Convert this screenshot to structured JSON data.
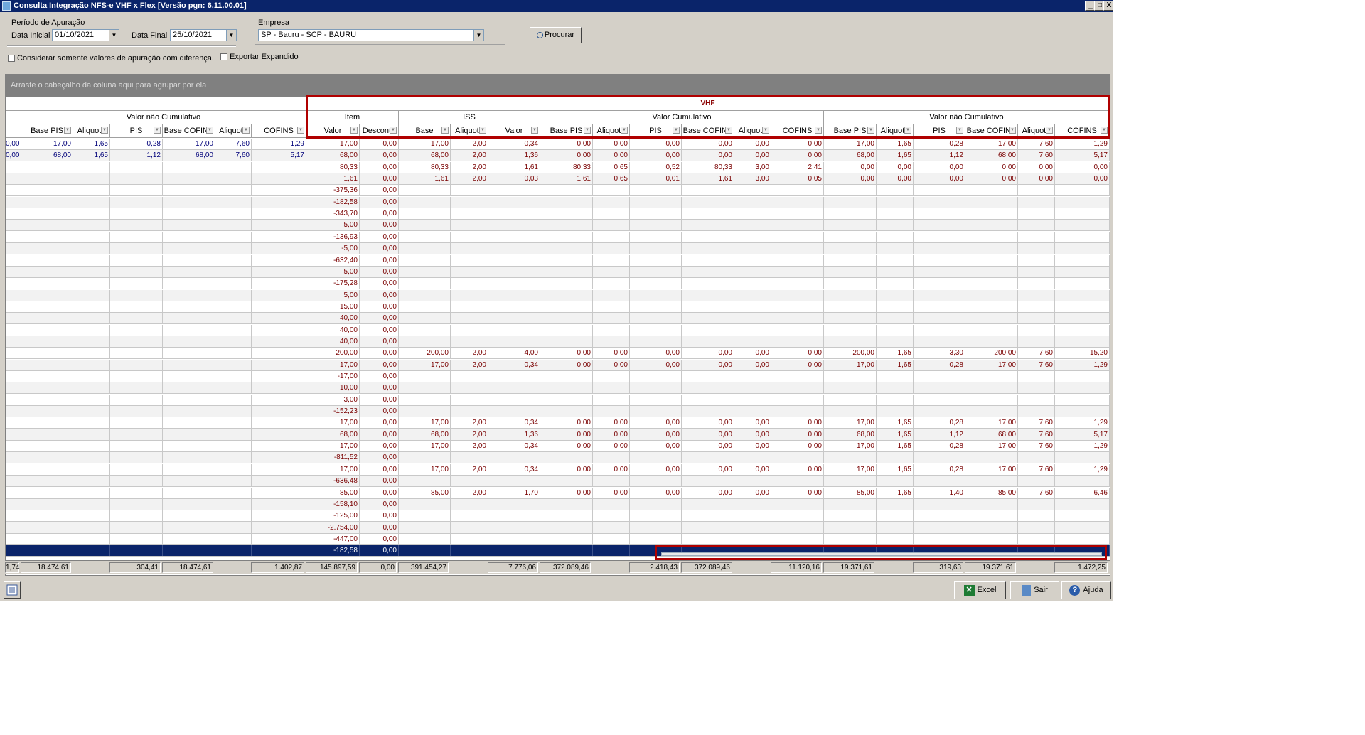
{
  "window": {
    "title": "Consulta Integração NFS-e VHF x Flex [Versão pgn: 6.11.00.01]",
    "buttons": [
      "_",
      "□",
      "X"
    ]
  },
  "filters": {
    "periodo_label": "Período de Apuração",
    "data_inicial_label": "Data Inicial",
    "data_inicial_value": "01/10/2021",
    "data_final_label": "Data Final",
    "data_final_value": "25/10/2021",
    "empresa_label": "Empresa",
    "empresa_value": "SP - Bauru - SCP - BAURU",
    "procurar_label": "Procurar",
    "considerar_label": "Considerar somente valores de apuração com diferença.",
    "exportar_label": "Exportar Expandido"
  },
  "grid": {
    "group_hint": "Arraste o cabeçalho da coluna aqui para agrupar por ela",
    "top_band": "VHF",
    "bands": [
      {
        "id": "vnc1",
        "label": "Valor não Cumulativo"
      },
      {
        "id": "item",
        "label": "Item"
      },
      {
        "id": "iss",
        "label": "ISS"
      },
      {
        "id": "vc",
        "label": "Valor Cumulativo"
      },
      {
        "id": "vnc2",
        "label": "Valor não Cumulativo"
      }
    ],
    "columns": [
      "",
      "Base PIS",
      "Aliquota",
      "PIS",
      "Base COFINS",
      "Aliquota",
      "COFINS",
      "Valor",
      "Desconto",
      "Base",
      "Aliquota",
      "Valor",
      "Base PIS",
      "Aliquota",
      "PIS",
      "Base COFINS",
      "Aliquota",
      "COFINS",
      "Base PIS",
      "Aliquota",
      "PIS",
      "Base COFINS",
      "Aliquota",
      "COFINS"
    ],
    "rows": [
      [
        "0,00",
        "17,00",
        "1,65",
        "0,28",
        "17,00",
        "7,60",
        "1,29",
        "17,00",
        "0,00",
        "17,00",
        "2,00",
        "0,34",
        "0,00",
        "0,00",
        "0,00",
        "0,00",
        "0,00",
        "0,00",
        "17,00",
        "1,65",
        "0,28",
        "17,00",
        "7,60",
        "1,29"
      ],
      [
        "0,00",
        "68,00",
        "1,65",
        "1,12",
        "68,00",
        "7,60",
        "5,17",
        "68,00",
        "0,00",
        "68,00",
        "2,00",
        "1,36",
        "0,00",
        "0,00",
        "0,00",
        "0,00",
        "0,00",
        "0,00",
        "68,00",
        "1,65",
        "1,12",
        "68,00",
        "7,60",
        "5,17"
      ],
      [
        "",
        "",
        "",
        "",
        "",
        "",
        "",
        "80,33",
        "0,00",
        "80,33",
        "2,00",
        "1,61",
        "80,33",
        "0,65",
        "0,52",
        "80,33",
        "3,00",
        "2,41",
        "0,00",
        "0,00",
        "0,00",
        "0,00",
        "0,00",
        "0,00"
      ],
      [
        "",
        "",
        "",
        "",
        "",
        "",
        "",
        "1,61",
        "0,00",
        "1,61",
        "2,00",
        "0,03",
        "1,61",
        "0,65",
        "0,01",
        "1,61",
        "3,00",
        "0,05",
        "0,00",
        "0,00",
        "0,00",
        "0,00",
        "0,00",
        "0,00"
      ],
      [
        "",
        "",
        "",
        "",
        "",
        "",
        "",
        "-375,36",
        "0,00",
        "",
        "",
        "",
        "",
        "",
        "",
        "",
        "",
        "",
        "",
        "",
        "",
        "",
        "",
        ""
      ],
      [
        "",
        "",
        "",
        "",
        "",
        "",
        "",
        "-182,58",
        "0,00",
        "",
        "",
        "",
        "",
        "",
        "",
        "",
        "",
        "",
        "",
        "",
        "",
        "",
        "",
        ""
      ],
      [
        "",
        "",
        "",
        "",
        "",
        "",
        "",
        "-343,70",
        "0,00",
        "",
        "",
        "",
        "",
        "",
        "",
        "",
        "",
        "",
        "",
        "",
        "",
        "",
        "",
        ""
      ],
      [
        "",
        "",
        "",
        "",
        "",
        "",
        "",
        "5,00",
        "0,00",
        "",
        "",
        "",
        "",
        "",
        "",
        "",
        "",
        "",
        "",
        "",
        "",
        "",
        "",
        ""
      ],
      [
        "",
        "",
        "",
        "",
        "",
        "",
        "",
        "-136,93",
        "0,00",
        "",
        "",
        "",
        "",
        "",
        "",
        "",
        "",
        "",
        "",
        "",
        "",
        "",
        "",
        ""
      ],
      [
        "",
        "",
        "",
        "",
        "",
        "",
        "",
        "-5,00",
        "0,00",
        "",
        "",
        "",
        "",
        "",
        "",
        "",
        "",
        "",
        "",
        "",
        "",
        "",
        "",
        ""
      ],
      [
        "",
        "",
        "",
        "",
        "",
        "",
        "",
        "-632,40",
        "0,00",
        "",
        "",
        "",
        "",
        "",
        "",
        "",
        "",
        "",
        "",
        "",
        "",
        "",
        "",
        ""
      ],
      [
        "",
        "",
        "",
        "",
        "",
        "",
        "",
        "5,00",
        "0,00",
        "",
        "",
        "",
        "",
        "",
        "",
        "",
        "",
        "",
        "",
        "",
        "",
        "",
        "",
        ""
      ],
      [
        "",
        "",
        "",
        "",
        "",
        "",
        "",
        "-175,28",
        "0,00",
        "",
        "",
        "",
        "",
        "",
        "",
        "",
        "",
        "",
        "",
        "",
        "",
        "",
        "",
        ""
      ],
      [
        "",
        "",
        "",
        "",
        "",
        "",
        "",
        "5,00",
        "0,00",
        "",
        "",
        "",
        "",
        "",
        "",
        "",
        "",
        "",
        "",
        "",
        "",
        "",
        "",
        ""
      ],
      [
        "",
        "",
        "",
        "",
        "",
        "",
        "",
        "15,00",
        "0,00",
        "",
        "",
        "",
        "",
        "",
        "",
        "",
        "",
        "",
        "",
        "",
        "",
        "",
        "",
        ""
      ],
      [
        "",
        "",
        "",
        "",
        "",
        "",
        "",
        "40,00",
        "0,00",
        "",
        "",
        "",
        "",
        "",
        "",
        "",
        "",
        "",
        "",
        "",
        "",
        "",
        "",
        ""
      ],
      [
        "",
        "",
        "",
        "",
        "",
        "",
        "",
        "40,00",
        "0,00",
        "",
        "",
        "",
        "",
        "",
        "",
        "",
        "",
        "",
        "",
        "",
        "",
        "",
        "",
        ""
      ],
      [
        "",
        "",
        "",
        "",
        "",
        "",
        "",
        "40,00",
        "0,00",
        "",
        "",
        "",
        "",
        "",
        "",
        "",
        "",
        "",
        "",
        "",
        "",
        "",
        "",
        ""
      ],
      [
        "",
        "",
        "",
        "",
        "",
        "",
        "",
        "200,00",
        "0,00",
        "200,00",
        "2,00",
        "4,00",
        "0,00",
        "0,00",
        "0,00",
        "0,00",
        "0,00",
        "0,00",
        "200,00",
        "1,65",
        "3,30",
        "200,00",
        "7,60",
        "15,20"
      ],
      [
        "",
        "",
        "",
        "",
        "",
        "",
        "",
        "17,00",
        "0,00",
        "17,00",
        "2,00",
        "0,34",
        "0,00",
        "0,00",
        "0,00",
        "0,00",
        "0,00",
        "0,00",
        "17,00",
        "1,65",
        "0,28",
        "17,00",
        "7,60",
        "1,29"
      ],
      [
        "",
        "",
        "",
        "",
        "",
        "",
        "",
        "-17,00",
        "0,00",
        "",
        "",
        "",
        "",
        "",
        "",
        "",
        "",
        "",
        "",
        "",
        "",
        "",
        "",
        ""
      ],
      [
        "",
        "",
        "",
        "",
        "",
        "",
        "",
        "10,00",
        "0,00",
        "",
        "",
        "",
        "",
        "",
        "",
        "",
        "",
        "",
        "",
        "",
        "",
        "",
        "",
        ""
      ],
      [
        "",
        "",
        "",
        "",
        "",
        "",
        "",
        "3,00",
        "0,00",
        "",
        "",
        "",
        "",
        "",
        "",
        "",
        "",
        "",
        "",
        "",
        "",
        "",
        "",
        ""
      ],
      [
        "",
        "",
        "",
        "",
        "",
        "",
        "",
        "-152,23",
        "0,00",
        "",
        "",
        "",
        "",
        "",
        "",
        "",
        "",
        "",
        "",
        "",
        "",
        "",
        "",
        ""
      ],
      [
        "",
        "",
        "",
        "",
        "",
        "",
        "",
        "17,00",
        "0,00",
        "17,00",
        "2,00",
        "0,34",
        "0,00",
        "0,00",
        "0,00",
        "0,00",
        "0,00",
        "0,00",
        "17,00",
        "1,65",
        "0,28",
        "17,00",
        "7,60",
        "1,29"
      ],
      [
        "",
        "",
        "",
        "",
        "",
        "",
        "",
        "68,00",
        "0,00",
        "68,00",
        "2,00",
        "1,36",
        "0,00",
        "0,00",
        "0,00",
        "0,00",
        "0,00",
        "0,00",
        "68,00",
        "1,65",
        "1,12",
        "68,00",
        "7,60",
        "5,17"
      ],
      [
        "",
        "",
        "",
        "",
        "",
        "",
        "",
        "17,00",
        "0,00",
        "17,00",
        "2,00",
        "0,34",
        "0,00",
        "0,00",
        "0,00",
        "0,00",
        "0,00",
        "0,00",
        "17,00",
        "1,65",
        "0,28",
        "17,00",
        "7,60",
        "1,29"
      ],
      [
        "",
        "",
        "",
        "",
        "",
        "",
        "",
        "-811,52",
        "0,00",
        "",
        "",
        "",
        "",
        "",
        "",
        "",
        "",
        "",
        "",
        "",
        "",
        "",
        "",
        ""
      ],
      [
        "",
        "",
        "",
        "",
        "",
        "",
        "",
        "17,00",
        "0,00",
        "17,00",
        "2,00",
        "0,34",
        "0,00",
        "0,00",
        "0,00",
        "0,00",
        "0,00",
        "0,00",
        "17,00",
        "1,65",
        "0,28",
        "17,00",
        "7,60",
        "1,29"
      ],
      [
        "",
        "",
        "",
        "",
        "",
        "",
        "",
        "-636,48",
        "0,00",
        "",
        "",
        "",
        "",
        "",
        "",
        "",
        "",
        "",
        "",
        "",
        "",
        "",
        "",
        ""
      ],
      [
        "",
        "",
        "",
        "",
        "",
        "",
        "",
        "85,00",
        "0,00",
        "85,00",
        "2,00",
        "1,70",
        "0,00",
        "0,00",
        "0,00",
        "0,00",
        "0,00",
        "0,00",
        "85,00",
        "1,65",
        "1,40",
        "85,00",
        "7,60",
        "6,46"
      ],
      [
        "",
        "",
        "",
        "",
        "",
        "",
        "",
        "-158,10",
        "0,00",
        "",
        "",
        "",
        "",
        "",
        "",
        "",
        "",
        "",
        "",
        "",
        "",
        "",
        "",
        ""
      ],
      [
        "",
        "",
        "",
        "",
        "",
        "",
        "",
        "-125,00",
        "0,00",
        "",
        "",
        "",
        "",
        "",
        "",
        "",
        "",
        "",
        "",
        "",
        "",
        "",
        "",
        ""
      ],
      [
        "",
        "",
        "",
        "",
        "",
        "",
        "",
        "-2.754,00",
        "0,00",
        "",
        "",
        "",
        "",
        "",
        "",
        "",
        "",
        "",
        "",
        "",
        "",
        "",
        "",
        ""
      ],
      [
        "",
        "",
        "",
        "",
        "",
        "",
        "",
        "-447,00",
        "0,00",
        "",
        "",
        "",
        "",
        "",
        "",
        "",
        "",
        "",
        "",
        "",
        "",
        "",
        "",
        ""
      ],
      [
        "",
        "",
        "",
        "",
        "",
        "",
        "",
        "-182,58",
        "0,00",
        "",
        "",
        "",
        "",
        "",
        "",
        "",
        "",
        "",
        "",
        "",
        "",
        "",
        "",
        ""
      ]
    ],
    "selected_row": 35,
    "totals": [
      "1,74",
      "18.474,61",
      "",
      "304,41",
      "18.474,61",
      "",
      "1.402,87",
      "145.897,59",
      "0,00",
      "391.454,27",
      "",
      "7.776,06",
      "372.089,46",
      "",
      "2.418,43",
      "372.089,46",
      "",
      "11.120,16",
      "19.371,61",
      "",
      "319,63",
      "19.371,61",
      "",
      "1.472,25"
    ]
  },
  "bottom_buttons": {
    "excel": "Excel",
    "sair": "Sair",
    "ajuda": "Ajuda"
  },
  "colors": {
    "title_bg": "#0a246a",
    "value_red": "#7a0000",
    "value_blue": "#00007a",
    "highlight_box": "#b00000"
  }
}
